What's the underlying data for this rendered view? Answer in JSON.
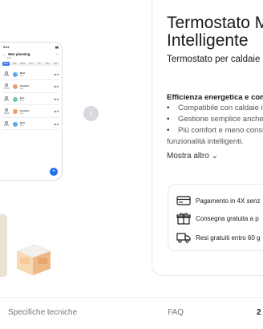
{
  "product": {
    "title_line1": "Termostato M",
    "title_line2": "Intelligente",
    "subtitle": "Termostato per caldaie",
    "features_title": "Efficienza energetica e comf",
    "features": [
      "Compatibile con caldaie i",
      "Gestione semplice anche c",
      "Più comfort e meno consu"
    ],
    "features_tail": "funzionalità intelligenti.",
    "more_label": "Mostra altro"
  },
  "benefits": [
    {
      "icon": "credit-card-icon",
      "text": "Pagamento in 4X senz"
    },
    {
      "icon": "gift-icon",
      "text": "Consegna gratuita a p"
    },
    {
      "icon": "truck-icon",
      "text": "Resi gratuiti entro 60 g"
    }
  ],
  "phone": {
    "time": "9:41",
    "header_title": "Mon planning",
    "header_sub": "Edit",
    "days": [
      "Mon",
      "Tue",
      "Wed",
      "Thu",
      "Fri",
      "Sat",
      "Sun"
    ],
    "rows": [
      {
        "time": "00:00",
        "label": "Noit",
        "sub": "Eco",
        "temp": "16.0°",
        "color": "#5aa9e6"
      },
      {
        "time": "07:00",
        "label": "Confort",
        "sub": "Eco",
        "temp": "19.0°",
        "color": "#f29b6f"
      },
      {
        "time": "09:00",
        "label": "Eco",
        "sub": "Eco",
        "temp": "16.0°",
        "color": "#6fc7c0"
      },
      {
        "time": "18:00",
        "label": "Confort",
        "sub": "Eco",
        "temp": "19.0°",
        "color": "#f29b6f"
      },
      {
        "time": "22:00",
        "label": "Noit",
        "sub": "Eco",
        "temp": "16.0°",
        "color": "#5aa9e6"
      }
    ]
  },
  "footer": {
    "specs": "Specifiche tecniche",
    "faq": "FAQ",
    "num": "2"
  },
  "colors": {
    "accent": "#1e6ff0",
    "border": "#e4e6ea"
  }
}
